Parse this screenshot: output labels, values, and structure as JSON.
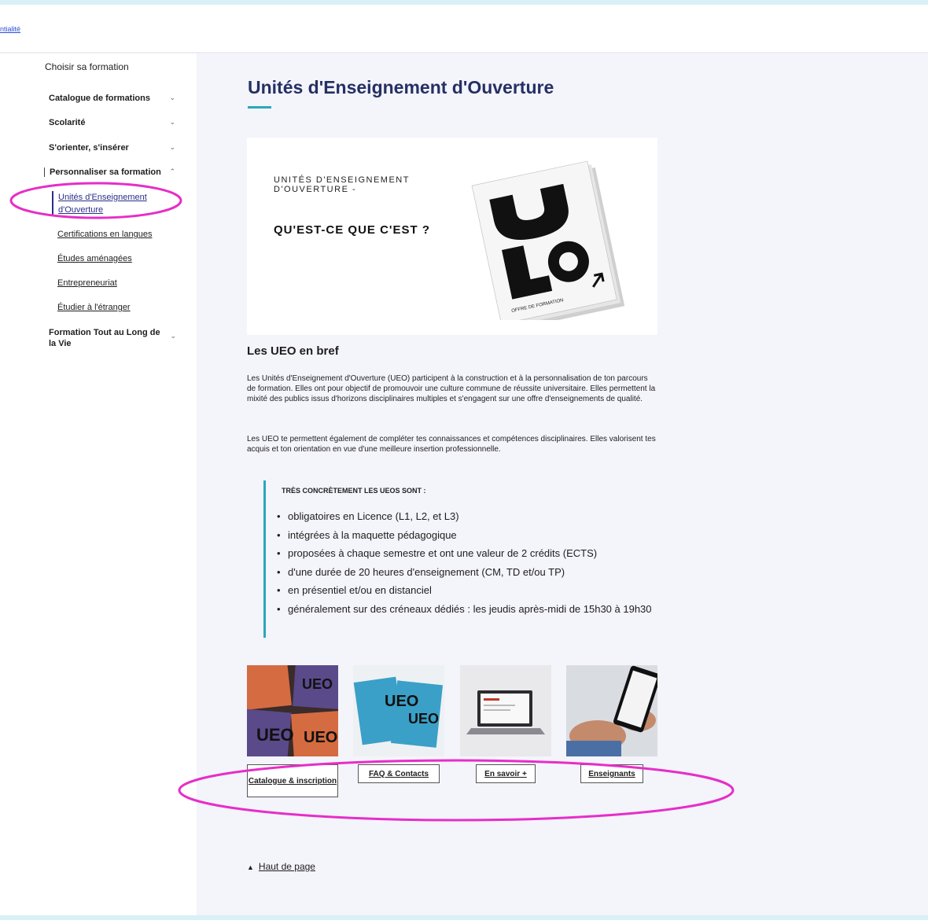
{
  "header": {
    "link_label": "ntialité"
  },
  "sidebar": {
    "title": "Choisir sa formation",
    "items": [
      {
        "label": "Catalogue de formations"
      },
      {
        "label": "Scolarité"
      },
      {
        "label": "S'orienter, s'insérer"
      },
      {
        "label": "Personnaliser sa formation"
      },
      {
        "label": "Formation Tout au Long de la Vie"
      }
    ],
    "sub_items": [
      {
        "label": "Unités d'Enseignement d'Ouverture"
      },
      {
        "label": "Certifications en langues"
      },
      {
        "label": "Études aménagées"
      },
      {
        "label": "Entrepreneuriat"
      },
      {
        "label": "Étudier à l'étranger"
      }
    ]
  },
  "main": {
    "title": "Unités d'Enseignement d'Ouverture",
    "hero": {
      "small_text": "UNITÉS D'ENSEIGNEMENT D'OUVERTURE -",
      "big_text": "QU'EST-CE QUE C'EST ?",
      "booklet_label": "OFFRE DE FORMATION"
    },
    "section_title": "Les UEO en bref",
    "paragraphs": [
      "Les Unités d'Enseignement d'Ouverture (UEO) participent à la construction et à la personnalisation de ton parcours de formation. Elles ont pour objectif de promouvoir une culture commune de réussite universitaire. Elles permettent la mixité des publics issus d'horizons disciplinaires multiples et s'engagent sur une offre d'enseignements de qualité.",
      "Les UEO te permettent également de compléter tes connaissances et compétences disciplinaires. Elles valorisent tes acquis et ton orientation en vue d'une meilleure insertion professionnelle."
    ],
    "callout": {
      "title": "TRÈS CONCRÈTEMENT LES UEOS SONT :",
      "items": [
        "obligatoires en Licence (L1, L2, et L3)",
        "intégrées à la maquette pédagogique",
        "proposées à chaque semestre et ont une valeur de 2 crédits (ECTS)",
        "d'une durée de 20 heures d'enseignement (CM, TD et/ou TP)",
        "en présentiel et/ou en distanciel",
        "généralement sur des créneaux dédiés : les jeudis après-midi de 15h30 à 19h30"
      ]
    },
    "cards": [
      {
        "label": "Catalogue & inscription"
      },
      {
        "label": "FAQ & Contacts"
      },
      {
        "label": "En savoir +"
      },
      {
        "label": "Enseignants"
      }
    ],
    "back_to_top": "Haut de page"
  },
  "colors": {
    "accent": "#2aa8b9",
    "annotation": "#e62ec8",
    "title": "#243064"
  }
}
